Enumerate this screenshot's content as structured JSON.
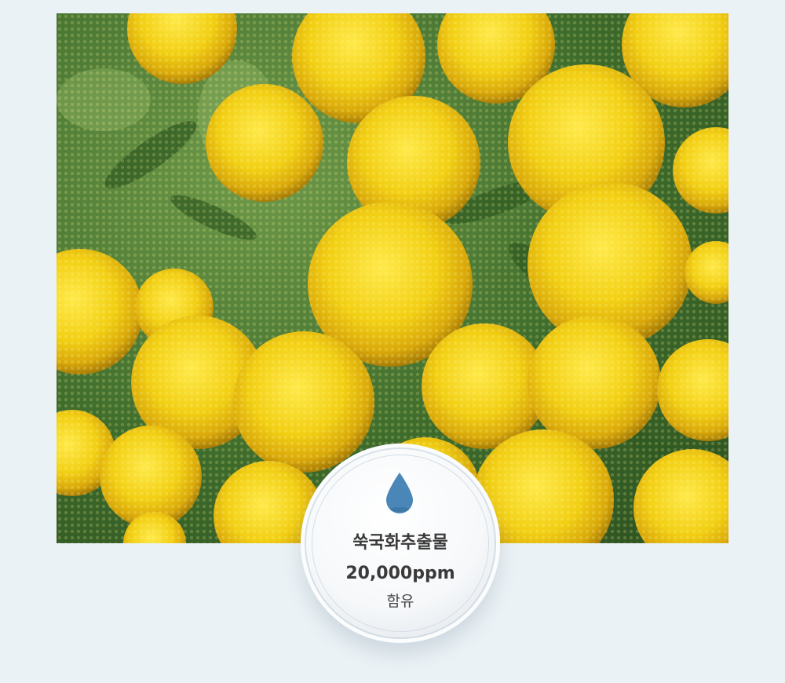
{
  "photo": {
    "subject": "yellow tansy flower heads",
    "icon": "flower-photo"
  },
  "badge": {
    "icon": "water-drop-icon",
    "title": "쑥국화추출물",
    "amount": "20,000ppm",
    "suffix": "함유",
    "drop_color": "#4a87b8"
  }
}
